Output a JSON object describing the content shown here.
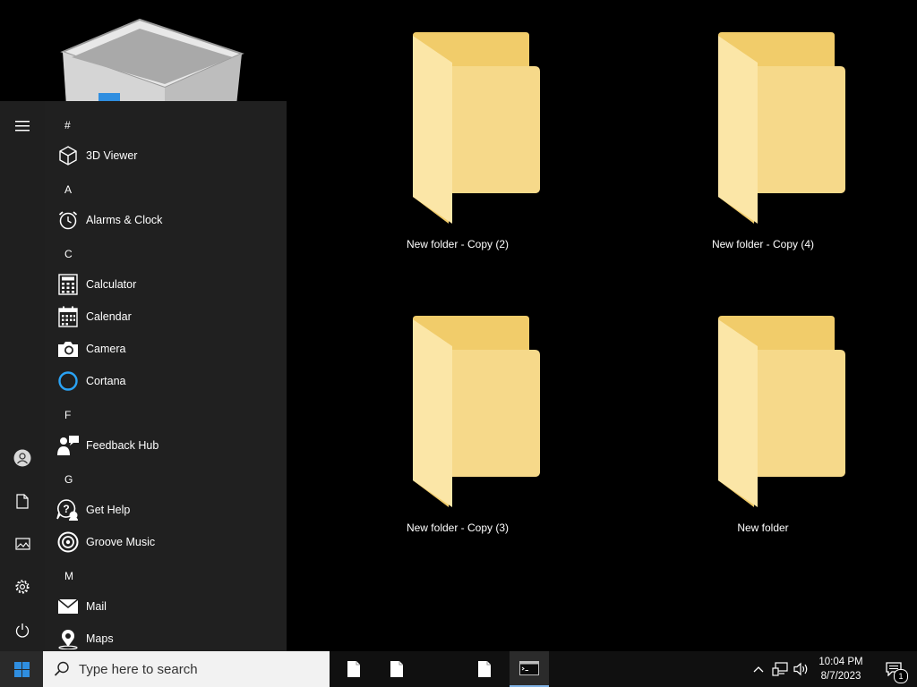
{
  "desktop": {
    "folders": [
      {
        "label": "New folder - Copy (2)"
      },
      {
        "label": "New folder - Copy (4)"
      },
      {
        "label": "New folder - Copy (3)"
      },
      {
        "label": "New folder"
      }
    ]
  },
  "start_menu": {
    "sections": [
      {
        "letter": "#",
        "apps": [
          {
            "name": "3D Viewer",
            "icon": "3d-viewer-icon"
          }
        ]
      },
      {
        "letter": "A",
        "apps": [
          {
            "name": "Alarms & Clock",
            "icon": "alarm-clock-icon"
          }
        ]
      },
      {
        "letter": "C",
        "apps": [
          {
            "name": "Calculator",
            "icon": "calculator-icon"
          },
          {
            "name": "Calendar",
            "icon": "calendar-icon"
          },
          {
            "name": "Camera",
            "icon": "camera-icon"
          },
          {
            "name": "Cortana",
            "icon": "cortana-icon"
          }
        ]
      },
      {
        "letter": "F",
        "apps": [
          {
            "name": "Feedback Hub",
            "icon": "feedback-hub-icon"
          }
        ]
      },
      {
        "letter": "G",
        "apps": [
          {
            "name": "Get Help",
            "icon": "get-help-icon"
          },
          {
            "name": "Groove Music",
            "icon": "groove-music-icon"
          }
        ]
      },
      {
        "letter": "M",
        "apps": [
          {
            "name": "Mail",
            "icon": "mail-icon"
          },
          {
            "name": "Maps",
            "icon": "maps-icon"
          }
        ]
      }
    ]
  },
  "taskbar": {
    "search_placeholder": "Type here to search",
    "clock_time": "10:04 PM",
    "clock_date": "8/7/2023",
    "notification_count": "1"
  },
  "colors": {
    "folder_front": "#f7d87a",
    "folder_back": "#e9c35a",
    "start_bg": "#202020",
    "taskbar_bg": "#101010",
    "windows_blue": "#2f8ee0",
    "cortana_blue": "#2aa3f5"
  }
}
